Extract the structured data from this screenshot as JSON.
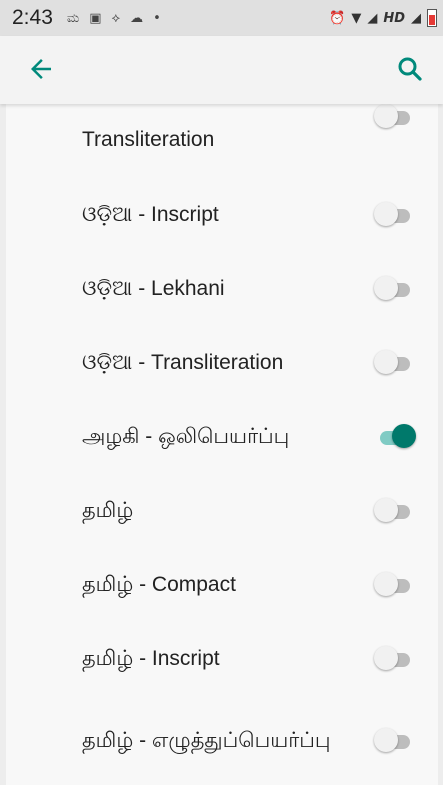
{
  "status_bar": {
    "time": "2:43",
    "network_label": "HD"
  },
  "app_bar": {
    "back_icon": "arrow-left-icon",
    "search_icon": "search-icon",
    "accent_color": "#00897b"
  },
  "languages": [
    {
      "label": "Transliteration",
      "enabled": false
    },
    {
      "label": "ଓଡ଼ିଆ - Inscript",
      "enabled": false
    },
    {
      "label": "ଓଡ଼ିଆ - Lekhani",
      "enabled": false
    },
    {
      "label": "ଓଡ଼ିଆ - Transliteration",
      "enabled": false
    },
    {
      "label": "அழகி - ஒலிபெயர்ப்பு",
      "enabled": true
    },
    {
      "label": "தமிழ்",
      "enabled": false
    },
    {
      "label": "தமிழ் - Compact",
      "enabled": false
    },
    {
      "label": "தமிழ் - Inscript",
      "enabled": false
    },
    {
      "label": "தமிழ் - எழுத்துப்பெயர்ப்பு",
      "enabled": false
    }
  ]
}
